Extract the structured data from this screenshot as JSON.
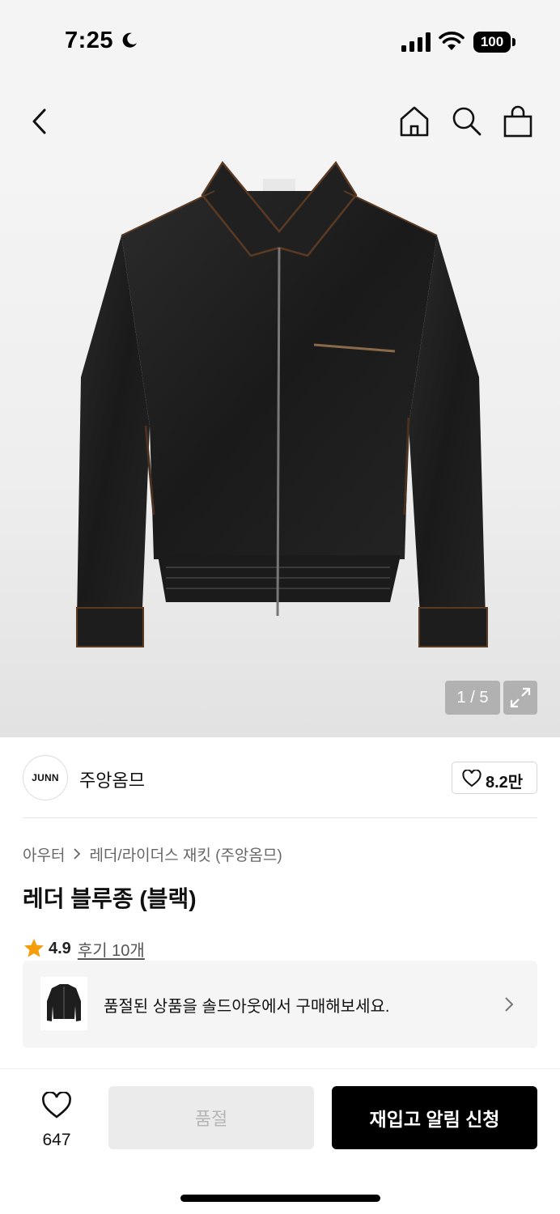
{
  "status_bar": {
    "time": "7:25",
    "battery": "100",
    "icons": [
      "moon-icon",
      "signal-icon",
      "wifi-icon",
      "battery-icon"
    ]
  },
  "nav": {
    "icons": [
      "back-icon",
      "home-icon",
      "search-icon",
      "shopping-bag-icon"
    ]
  },
  "hero": {
    "image": "black leather zip-up bomber jacket",
    "counter": "1 / 5",
    "expand_icon": "expand-icon"
  },
  "brand": {
    "logo_text": "JUNN",
    "name": "주앙옴므",
    "like_count": "8.2만"
  },
  "breadcrumb": {
    "items": [
      "아우터",
      "레더/라이더스 재킷 (주앙옴므)"
    ]
  },
  "product": {
    "title": "레더 블루종 (블랙)",
    "rating": "4.9",
    "reviews": "후기 10개"
  },
  "soldout_banner": {
    "message": "품절된 상품을 솔드아웃에서 구매해보세요."
  },
  "bottom_bar": {
    "wish_count": "647",
    "soldout_label": "품절",
    "restock_label": "재입고 알림 신청"
  },
  "colors": {
    "accent": "#000000",
    "star": "#f59e0b",
    "disabled_bg": "#ebebeb",
    "disabled_text": "#b5b5b5"
  }
}
